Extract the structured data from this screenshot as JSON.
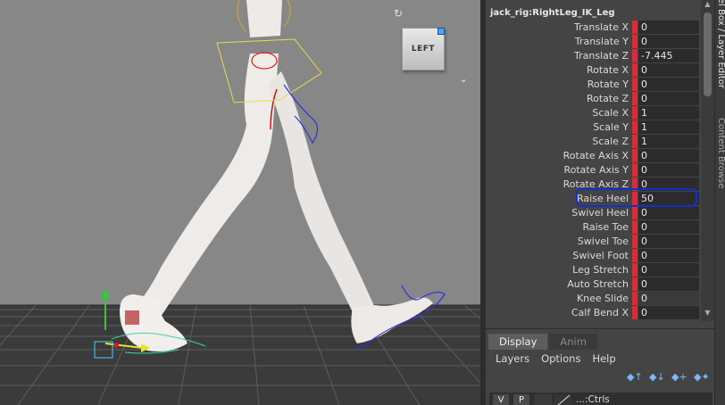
{
  "viewport": {
    "viewcube_label": "LEFT",
    "camera_icon": "camera-reset-icon",
    "menu_icon": "chevron-down-icon"
  },
  "channel_box": {
    "node_name": "jack_rig:RightLeg_IK_Leg",
    "attributes": [
      {
        "label": "Translate X",
        "value": "0"
      },
      {
        "label": "Translate Y",
        "value": "0"
      },
      {
        "label": "Translate Z",
        "value": "-7.445"
      },
      {
        "label": "Rotate X",
        "value": "0"
      },
      {
        "label": "Rotate Y",
        "value": "0"
      },
      {
        "label": "Rotate Z",
        "value": "0"
      },
      {
        "label": "Scale X",
        "value": "1"
      },
      {
        "label": "Scale Y",
        "value": "1"
      },
      {
        "label": "Scale Z",
        "value": "1"
      },
      {
        "label": "Rotate Axis X",
        "value": "0"
      },
      {
        "label": "Rotate Axis Y",
        "value": "0"
      },
      {
        "label": "Rotate Axis Z",
        "value": "0"
      },
      {
        "label": "Raise Heel",
        "value": "50"
      },
      {
        "label": "Swivel Heel",
        "value": "0"
      },
      {
        "label": "Raise Toe",
        "value": "0"
      },
      {
        "label": "Swivel Toe",
        "value": "0"
      },
      {
        "label": "Swivel Foot",
        "value": "0"
      },
      {
        "label": "Leg Stretch",
        "value": "0"
      },
      {
        "label": "Auto Stretch",
        "value": "0"
      },
      {
        "label": "Knee Slide",
        "value": "0"
      },
      {
        "label": "Calf Bend X",
        "value": "0"
      }
    ],
    "key_color": "#d72c3a",
    "highlight_color": "#1530c8"
  },
  "side_tabs": {
    "channel_box_tab": "el Box / Layer Editor",
    "content_browser_tab": "Content Browser"
  },
  "layer_editor": {
    "tabs": [
      "Display",
      "Anim"
    ],
    "active_tab": "Display",
    "menu": [
      "Layers",
      "Options",
      "Help"
    ],
    "layer": {
      "v": "V",
      "p": "P",
      "name": "...:Ctrls"
    },
    "icons": [
      "move-layer-up-icon",
      "move-layer-down-icon",
      "new-layer-selected-icon",
      "new-layer-icon"
    ]
  }
}
